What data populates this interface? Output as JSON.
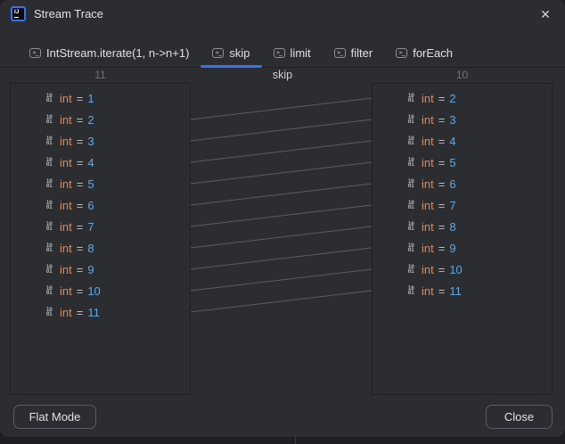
{
  "titlebar": {
    "title": "Stream Trace",
    "icon_text": "IJ",
    "close_glyph": "✕"
  },
  "tabs": [
    {
      "label": "IntStream.iterate(1, n->n+1)",
      "selected": false
    },
    {
      "label": "skip",
      "selected": true
    },
    {
      "label": "limit",
      "selected": false
    },
    {
      "label": "filter",
      "selected": false
    },
    {
      "label": "forEach",
      "selected": false
    }
  ],
  "header": {
    "left_count": "11",
    "operation": "skip",
    "right_count": "10"
  },
  "symbols": {
    "eq": "=",
    "value_icon_top": "10",
    "value_icon_bottom": "01",
    "tab_icon_glyph": ">_"
  },
  "left_panel": {
    "items": [
      {
        "type": "int",
        "value": "1"
      },
      {
        "type": "int",
        "value": "2"
      },
      {
        "type": "int",
        "value": "3"
      },
      {
        "type": "int",
        "value": "4"
      },
      {
        "type": "int",
        "value": "5"
      },
      {
        "type": "int",
        "value": "6"
      },
      {
        "type": "int",
        "value": "7"
      },
      {
        "type": "int",
        "value": "8"
      },
      {
        "type": "int",
        "value": "9"
      },
      {
        "type": "int",
        "value": "10"
      },
      {
        "type": "int",
        "value": "11"
      }
    ]
  },
  "right_panel": {
    "items": [
      {
        "type": "int",
        "value": "2"
      },
      {
        "type": "int",
        "value": "3"
      },
      {
        "type": "int",
        "value": "4"
      },
      {
        "type": "int",
        "value": "5"
      },
      {
        "type": "int",
        "value": "6"
      },
      {
        "type": "int",
        "value": "7"
      },
      {
        "type": "int",
        "value": "8"
      },
      {
        "type": "int",
        "value": "9"
      },
      {
        "type": "int",
        "value": "10"
      },
      {
        "type": "int",
        "value": "11"
      }
    ]
  },
  "connections": [
    [
      1,
      0
    ],
    [
      2,
      1
    ],
    [
      3,
      2
    ],
    [
      4,
      3
    ],
    [
      5,
      4
    ],
    [
      6,
      5
    ],
    [
      7,
      6
    ],
    [
      8,
      7
    ],
    [
      9,
      8
    ],
    [
      10,
      9
    ]
  ],
  "footer": {
    "flat_mode_label": "Flat Mode",
    "close_label": "Close"
  },
  "colors": {
    "accent": "#3574F0",
    "type_color": "#CF8E6D",
    "value_color": "#64A8E0",
    "line_color": "#5A5E63"
  }
}
